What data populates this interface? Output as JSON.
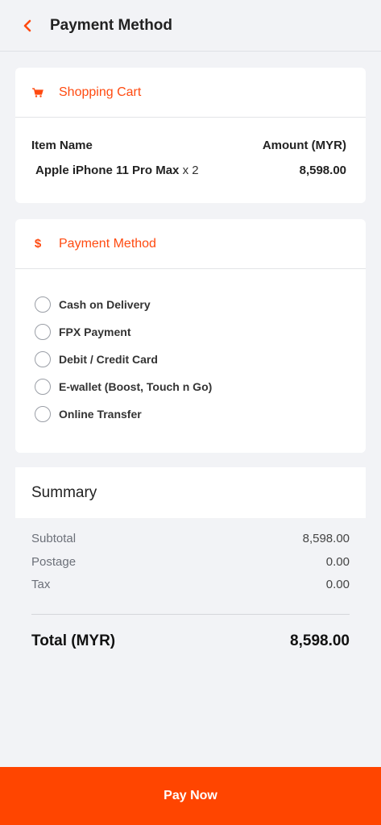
{
  "header": {
    "title": "Payment Method",
    "back_icon": "chevron-left-icon"
  },
  "accent_color": "#ff4a10",
  "cart": {
    "title": "Shopping Cart",
    "icon": "cart-icon",
    "col_item": "Item Name",
    "col_amount": "Amount (MYR)",
    "items": [
      {
        "name": "Apple iPhone 11 Pro Max",
        "qty": "x 2",
        "amount": "8,598.00"
      }
    ]
  },
  "payment": {
    "title": "Payment Method",
    "icon": "dollar-icon",
    "options": [
      {
        "label": "Cash on Delivery"
      },
      {
        "label": "FPX Payment"
      },
      {
        "label": "Debit / Credit Card"
      },
      {
        "label": "E-wallet (Boost, Touch n Go)"
      },
      {
        "label": "Online Transfer"
      }
    ]
  },
  "summary": {
    "title": "Summary",
    "subtotal_label": "Subtotal",
    "subtotal_value": "8,598.00",
    "postage_label": "Postage",
    "postage_value": "0.00",
    "tax_label": "Tax",
    "tax_value": "0.00",
    "total_label": "Total (MYR)",
    "total_value": "8,598.00"
  },
  "footer": {
    "pay_label": "Pay Now",
    "button_color": "#ff4500"
  }
}
